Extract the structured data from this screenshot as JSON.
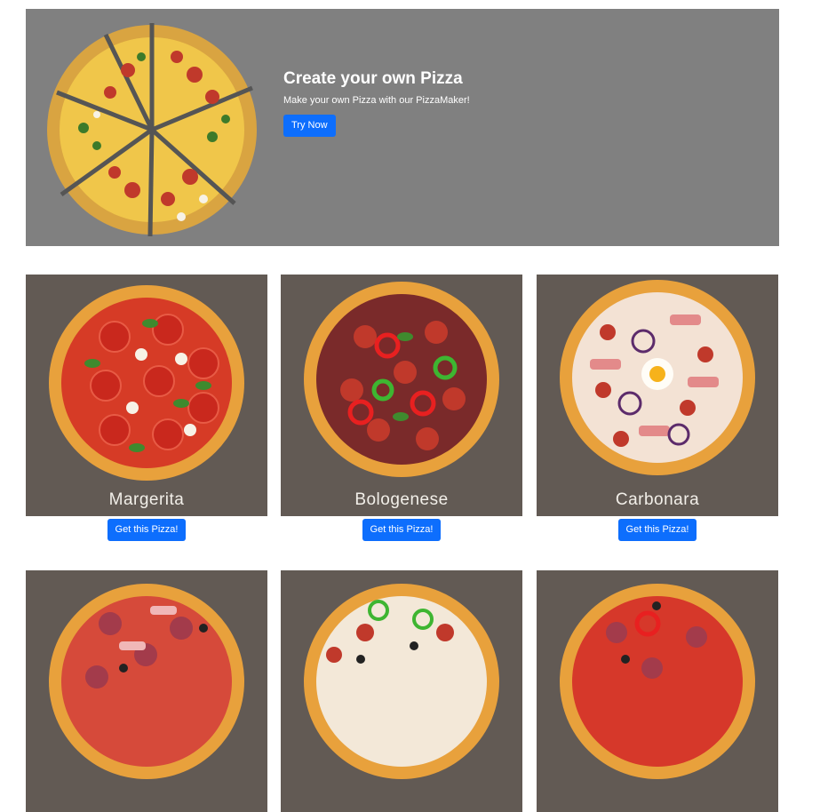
{
  "hero": {
    "title": "Create your own Pizza",
    "subtitle": "Make your own Pizza with our PizzaMaker!",
    "button_label": "Try Now",
    "background": "#808080"
  },
  "accent_color": "#0d6efd",
  "pizzas": [
    {
      "name": "Margerita",
      "button_label": "Get this Pizza!"
    },
    {
      "name": "Bologenese",
      "button_label": "Get this Pizza!"
    },
    {
      "name": "Carbonara",
      "button_label": "Get this Pizza!"
    },
    {
      "name": "",
      "button_label": ""
    },
    {
      "name": "",
      "button_label": ""
    },
    {
      "name": "",
      "button_label": ""
    }
  ]
}
